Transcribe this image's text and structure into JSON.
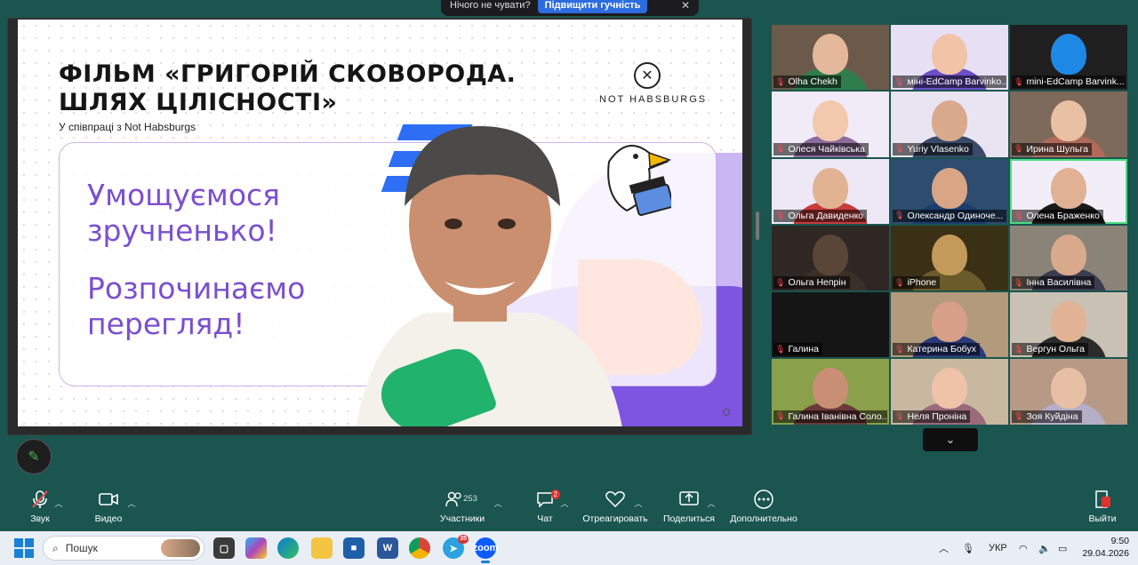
{
  "notification": {
    "text": "Нічого не чувати?",
    "button_label": "Підвищити гучність",
    "close_icon": "close-icon"
  },
  "slide": {
    "title": "ФІЛЬМ «ГРИГОРІЙ СКОВОРОДА.\nШЛЯХ ЦІЛІСНОСТІ»",
    "subtitle": "У співпраці з Not Habsburgs",
    "logo_text": "NOT HABSBURGS",
    "text_1": "Умощуємося\nзручненько!",
    "text_2": "Розпочинаємо\nперегляд!"
  },
  "participants": [
    {
      "name": "Olha Chekh",
      "muted": true,
      "bg": "#6b5a4a",
      "face": "#e4b89a",
      "shirt": "#2f7d4a"
    },
    {
      "name": "міні-EdCamp Barvinko...",
      "muted": true,
      "bg": "#e7e0f5",
      "face": "#f1c4a8",
      "shirt": "#6a4fc8"
    },
    {
      "name": "mini-EdCamp Barvink...",
      "muted": true,
      "bg": "#1f1f1f",
      "face": "#1e88e5",
      "shirt": "#1f1f1f"
    },
    {
      "name": "Олеся Чайківська",
      "muted": true,
      "bg": "#f0ebf7",
      "face": "#f2c9ad",
      "shirt": "#8c6c9c"
    },
    {
      "name": "Yuriy Vlasenko",
      "muted": true,
      "bg": "#e9e4f2",
      "face": "#d9a98c",
      "shirt": "#3a4a68"
    },
    {
      "name": "Ирина Шульга",
      "muted": true,
      "bg": "#7d6a5a",
      "face": "#e8c0a4",
      "shirt": "#b06a5a"
    },
    {
      "name": "Ольга Давиденко",
      "muted": true,
      "bg": "#eee8f6",
      "face": "#e2b393",
      "shirt": "#c83c3c"
    },
    {
      "name": "Олександр Одиноче...",
      "muted": true,
      "bg": "#2d4c6e",
      "face": "#d8a585",
      "shirt": "#1d3d6e"
    },
    {
      "name": "Олена Браженко",
      "muted": true,
      "bg": "#f2eef8",
      "face": "#e0b192",
      "shirt": "#1a1a1a"
    },
    {
      "name": "Ольга Непрін",
      "muted": true,
      "bg": "#2e2723",
      "face": "#5a4638",
      "shirt": "#3a3029"
    },
    {
      "name": "iPhone",
      "muted": true,
      "bg": "#3a3016",
      "face": "#c49a5a",
      "shirt": "#6b5b2a"
    },
    {
      "name": "Інна Василівна",
      "muted": true,
      "bg": "#8a8478",
      "face": "#d9a98c",
      "shirt": "#3c3c50"
    },
    {
      "name": "Галина",
      "muted": true,
      "bg": "#151515",
      "face": "#151515",
      "shirt": "#151515"
    },
    {
      "name": "Катерина Бобух",
      "muted": true,
      "bg": "#b29a7a",
      "face": "#d8a088",
      "shirt": "#2a3a7a"
    },
    {
      "name": "Вергун Ольга",
      "muted": true,
      "bg": "#c9c2b4",
      "face": "#e1b294",
      "shirt": "#2b2b2b"
    },
    {
      "name": "Галина Іванівна Соло...",
      "muted": true,
      "bg": "#8aa04a",
      "face": "#c98f74",
      "shirt": "#6a3a3a"
    },
    {
      "name": "Неля Проніна",
      "muted": true,
      "bg": "#c9b8a0",
      "face": "#eec3a8",
      "shirt": "#9a6a7a"
    },
    {
      "name": "Зоя Куйдіна",
      "muted": true,
      "bg": "#b69a86",
      "face": "#e7bfa4",
      "shirt": "#b4aec6"
    }
  ],
  "toolbar": {
    "audio_label": "Звук",
    "video_label": "Видео",
    "participants_label": "Участники",
    "participants_count": "253",
    "chat_label": "Чат",
    "chat_badge": "2",
    "react_label": "Отреагировать",
    "share_label": "Поделиться",
    "more_label": "Дополнительно",
    "leave_label": "Выйти"
  },
  "taskbar": {
    "search_placeholder": "Пошук",
    "telegram_badge": "35",
    "language": "УКР",
    "time": "9:50",
    "date": "29.04.2026"
  }
}
